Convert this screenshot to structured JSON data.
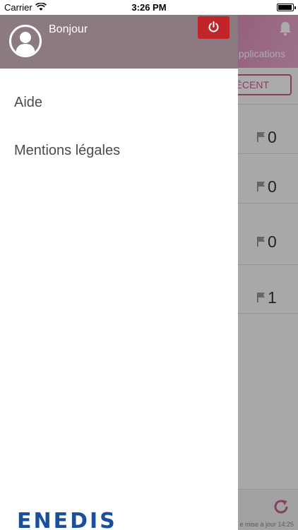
{
  "status_bar": {
    "carrier": "Carrier",
    "time": "3:26 PM"
  },
  "background_screen": {
    "header_label": "pplications",
    "recent_button": "ÉCENT",
    "counts": [
      "0",
      "0",
      "0",
      "1"
    ],
    "footer_update_text": "e mise à jour 14:25"
  },
  "drawer": {
    "greeting": "Bonjour",
    "menu": [
      {
        "label": "Aide"
      },
      {
        "label": "Mentions légales"
      }
    ],
    "logo_text": "ENEDIS"
  },
  "colors": {
    "drawer_header": "#8b7b80",
    "power_button": "#c0252a",
    "app_accent": "#c65f94",
    "logo_blue": "#1a4f9c"
  },
  "icons": [
    "wifi-icon",
    "battery-icon",
    "bell-icon",
    "avatar-icon",
    "power-icon",
    "flag-icon",
    "refresh-icon"
  ]
}
